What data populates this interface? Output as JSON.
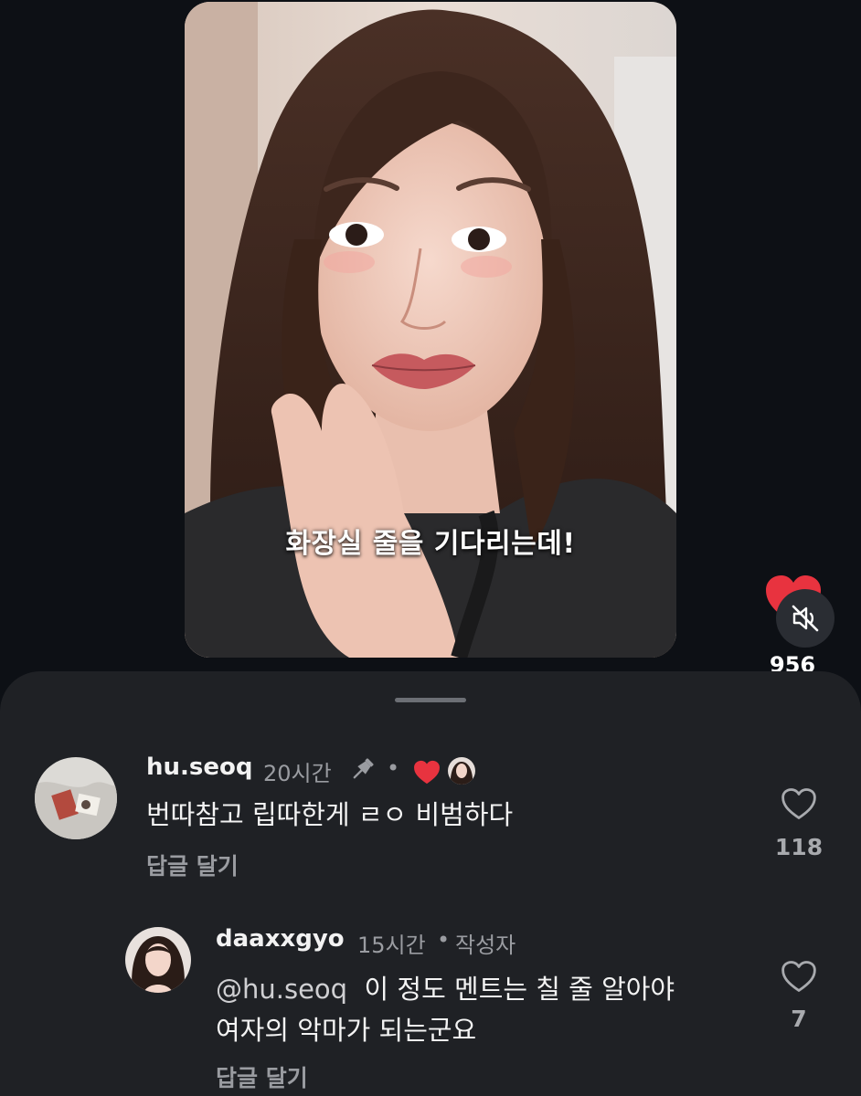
{
  "video": {
    "caption": "화장실 줄을 기다리는데!"
  },
  "actions": {
    "like_count": "956",
    "muted": true
  },
  "comments": [
    {
      "username": "hu.seoq",
      "time": "20시간",
      "pinned": true,
      "liked_by_author": true,
      "text": "번따참고 립따한게 ㄹㅇ 비범하다",
      "reply_label": "답글 달기",
      "likes": "118"
    },
    {
      "username": "daaxxgyo",
      "time": "15시간",
      "author_badge": "작성자",
      "mention": "@hu.seoq",
      "text_line1": "이 정도 멘트는 칠 줄 알아야",
      "text_line2": "여자의 악마가 되는군요",
      "reply_label": "답글 달기",
      "likes": "7"
    }
  ],
  "colors": {
    "background": "#0d1015",
    "sheet": "#1f2125",
    "heart_red": "#e8333f",
    "muted_text": "#9a9ca1"
  }
}
